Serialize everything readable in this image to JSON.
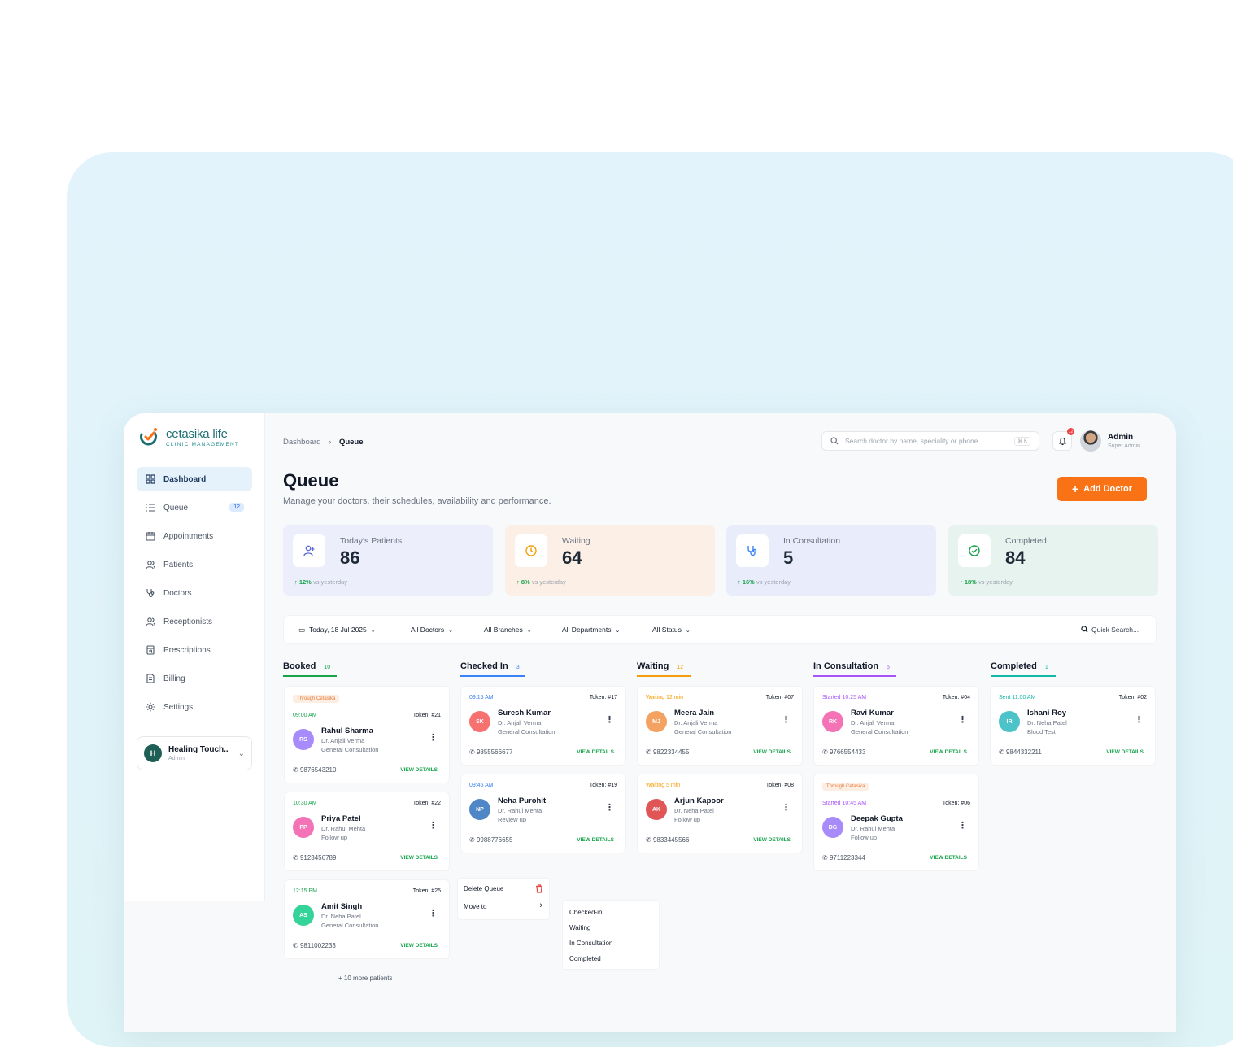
{
  "brand": {
    "name": "cetasika life",
    "tagline": "CLINIC MANAGEMENT"
  },
  "sidebar": {
    "items": [
      {
        "label": "Dashboard",
        "icon": "grid-icon",
        "active": true
      },
      {
        "label": "Queue",
        "icon": "list-icon",
        "badge": "12"
      },
      {
        "label": "Appointments",
        "icon": "calendar-icon"
      },
      {
        "label": "Patients",
        "icon": "users-icon"
      },
      {
        "label": "Doctors",
        "icon": "stethoscope-icon"
      },
      {
        "label": "Receptionists",
        "icon": "users-icon"
      },
      {
        "label": "Prescriptions",
        "icon": "prescription-icon"
      },
      {
        "label": "Billing",
        "icon": "document-icon"
      },
      {
        "label": "Settings",
        "icon": "gear-icon"
      }
    ],
    "clinic": {
      "initial": "H",
      "name": "Healing Touch..",
      "role": "Admin"
    }
  },
  "topbar": {
    "breadcrumb": {
      "root": "Dashboard",
      "current": "Queue"
    },
    "search_placeholder": "Search doctor by name, speciality or phone...",
    "search_shortcut": "⌘ K",
    "notif_count": "12",
    "user": {
      "name": "Admin",
      "role": "Super Admin"
    }
  },
  "page": {
    "title": "Queue",
    "subtitle": "Manage your doctors, their schedules, availability and performance.",
    "add_button": "Add Doctor"
  },
  "stats": [
    {
      "label": "Today's Patients",
      "value": "86",
      "trend": "12%",
      "trend_text": "vs yesterday",
      "bg": "#eceefc",
      "icon": "user-plus-icon",
      "icon_color": "#5b6bd6"
    },
    {
      "label": "Waiting",
      "value": "64",
      "trend": "8%",
      "trend_text": "vs yesterday",
      "bg": "#fbefe6",
      "icon": "clock-icon",
      "icon_color": "#f59e0b"
    },
    {
      "label": "In Consultation",
      "value": "5",
      "trend": "16%",
      "trend_text": "vs yesterday",
      "bg": "#e8ecfb",
      "icon": "stethoscope-icon",
      "icon_color": "#3b82f6"
    },
    {
      "label": "Completed",
      "value": "84",
      "trend": "18%",
      "trend_text": "vs yesterday",
      "bg": "#e6f3ee",
      "icon": "check-circle-icon",
      "icon_color": "#16a34a"
    }
  ],
  "filters": {
    "date": "Today, 18 Jul 2025",
    "doctors": "All Doctors",
    "branches": "All Branches",
    "departments": "All Departments",
    "status": "All Status",
    "quick_search": "Quick Search..."
  },
  "columns": [
    {
      "title": "Booked",
      "count": "10",
      "color": "#16a34a"
    },
    {
      "title": "Checked In",
      "count": "3",
      "color": "#3b82f6"
    },
    {
      "title": "Waiting",
      "count": "12",
      "color": "#f59e0b"
    },
    {
      "title": "In Consultation",
      "count": "5",
      "color": "#a855f7"
    },
    {
      "title": "Completed",
      "count": "1",
      "color": "#14b8a6"
    }
  ],
  "cards": {
    "booked": [
      {
        "tag": "Through Cetasika",
        "time": "09:00 AM",
        "token": "Token: #21",
        "initials": "RS",
        "name": "Rahul Sharma",
        "doctor": "Dr. Anjali Verma",
        "type": "General Consultation",
        "phone": "9876543210",
        "action": "VIEW DETAILS",
        "avatar_color": "#a78bfa"
      },
      {
        "time": "10:30 AM",
        "token": "Token: #22",
        "initials": "PP",
        "name": "Priya Patel",
        "doctor": "Dr. Rahul Mehta",
        "type": "Follow up",
        "phone": "9123456789",
        "action": "VIEW DETAILS",
        "avatar_color": "#f472b6"
      },
      {
        "time": "12:15 PM",
        "token": "Token: #25",
        "initials": "AS",
        "name": "Amit Singh",
        "doctor": "Dr. Neha Patel",
        "type": "General Consultation",
        "phone": "9811002233",
        "action": "VIEW DETAILS",
        "avatar_color": "#34d399"
      }
    ],
    "checked_in": [
      {
        "time": "09:15 AM",
        "token": "Token: #17",
        "initials": "SK",
        "name": "Suresh Kumar",
        "doctor": "Dr. Anjali Verma",
        "type": "General Consultation",
        "phone": "9855566677",
        "action": "VIEW DETAILS",
        "avatar_color": "#f87171"
      },
      {
        "time": "09:45 AM",
        "token": "Token: #19",
        "initials": "NP",
        "name": "Neha Purohit",
        "doctor": "Dr. Rahul Mehta",
        "type": "Review up",
        "phone": "9988776655",
        "action": "VIEW DETAILS",
        "avatar_color": "#4f86c6"
      }
    ],
    "waiting": [
      {
        "time": "Waiting 12 min",
        "token": "Token: #07",
        "initials": "MJ",
        "name": "Meera Jain",
        "doctor": "Dr. Anjali Verma",
        "type": "General Consultation",
        "phone": "9822334455",
        "action": "VIEW DETAILS",
        "avatar_color": "#f4a261"
      },
      {
        "time": "Waiting 5 min",
        "token": "Token: #08",
        "initials": "AK",
        "name": "Arjun Kapoor",
        "doctor": "Dr. Neha Patel",
        "type": "Follow up",
        "phone": "9833445566",
        "action": "VIEW DETAILS",
        "avatar_color": "#e05656"
      }
    ],
    "consultation": [
      {
        "time": "Started 10:25 AM",
        "token": "Token: #04",
        "initials": "RK",
        "name": "Ravi Kumar",
        "doctor": "Dr. Anjali Verma",
        "type": "General Consultation",
        "phone": "9766554433",
        "action": "VIEW DETAILS",
        "avatar_color": "#f472b6"
      },
      {
        "tag": "Through Cetasika",
        "time": "Started 10:45 AM",
        "token": "Token: #06",
        "initials": "DG",
        "name": "Deepak Gupta",
        "doctor": "Dr. Rahul Mehta",
        "type": "Follow up",
        "phone": "9711223344",
        "action": "VIEW DETAILS",
        "avatar_color": "#a78bfa"
      }
    ],
    "completed": [
      {
        "time": "Sent 11:00 AM",
        "token": "Token: #02",
        "initials": "IR",
        "name": "Ishani Roy",
        "doctor": "Dr. Neha Patel",
        "type": "Blood Test",
        "phone": "9844332211",
        "action": "VIEW DETAILS",
        "avatar_color": "#4cc3c9"
      }
    ]
  },
  "more_patients": "+ 10 more patients",
  "context_menu": {
    "delete": "Delete Queue",
    "move": "Move to"
  },
  "submenu": [
    "Checked-in",
    "Waiting",
    "In Consultation",
    "Completed"
  ]
}
